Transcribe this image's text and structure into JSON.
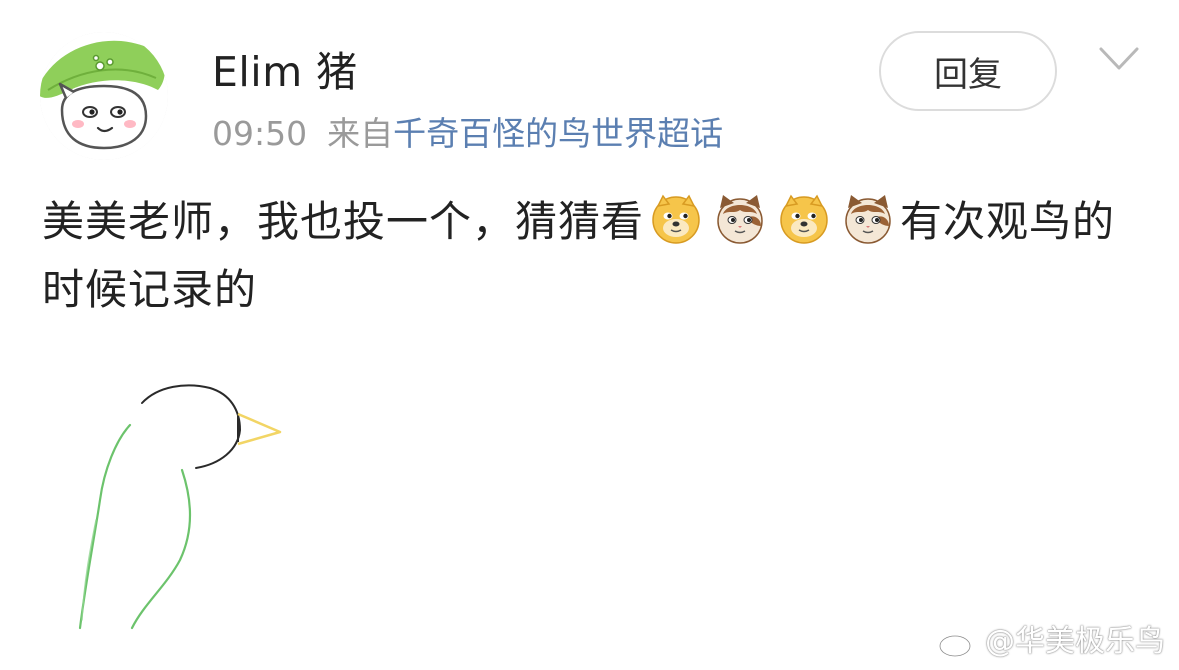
{
  "post": {
    "username": "Elim 猪",
    "time": "09:50",
    "source_prefix": "来自",
    "source_link": "千奇百怪的鸟世界超话",
    "reply_label": "回复",
    "text_part1": "美美老师，我也投一个，猜猜看",
    "text_part2": "有次观鸟的时候记录的",
    "emojis": [
      "doge-emoji",
      "cat-emoji",
      "doge-emoji",
      "cat-emoji"
    ]
  },
  "watermark": {
    "text": "@华美极乐鸟"
  },
  "colors": {
    "link": "#5b7fb1",
    "meta": "#9a9a9a",
    "text": "#222222",
    "sketch_green": "#6cc36c",
    "sketch_beak": "#f2d565"
  }
}
